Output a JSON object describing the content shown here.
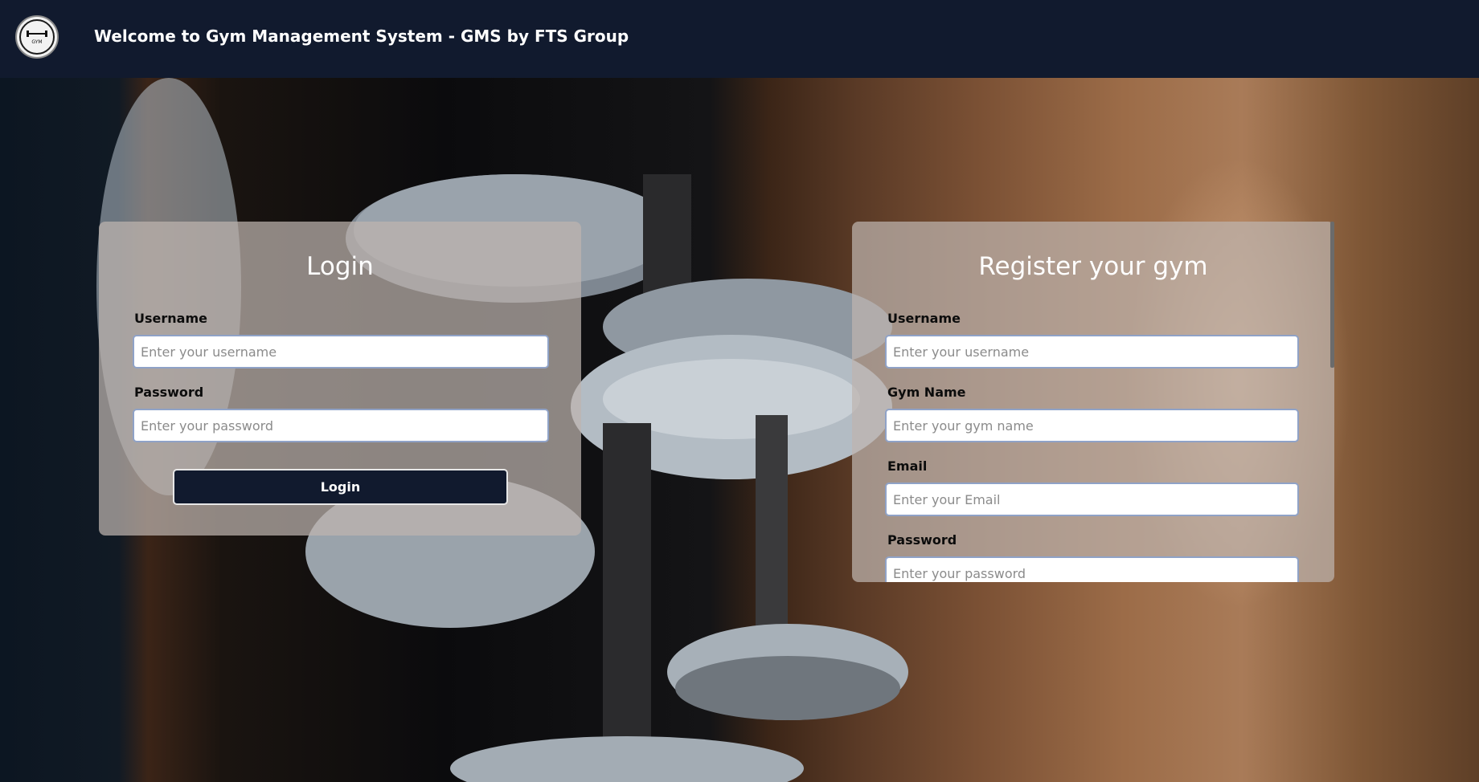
{
  "header": {
    "logo_text": "GYM",
    "title": "Welcome to Gym Management System - GMS by FTS Group"
  },
  "login": {
    "title": "Login",
    "username_label": "Username",
    "username_placeholder": "Enter your username",
    "password_label": "Password",
    "password_placeholder": "Enter your password",
    "button_label": "Login"
  },
  "register": {
    "title": "Register your gym",
    "username_label": "Username",
    "username_placeholder": "Enter your username",
    "gym_name_label": "Gym Name",
    "gym_name_placeholder": "Enter your gym name",
    "email_label": "Email",
    "email_placeholder": "Enter your Email",
    "password_label": "Password",
    "password_placeholder": "Enter your password"
  },
  "colors": {
    "navbar": "#111a2e",
    "button": "#111a2e",
    "card": "#bfb4af",
    "input_border": "#8fa2c7"
  }
}
